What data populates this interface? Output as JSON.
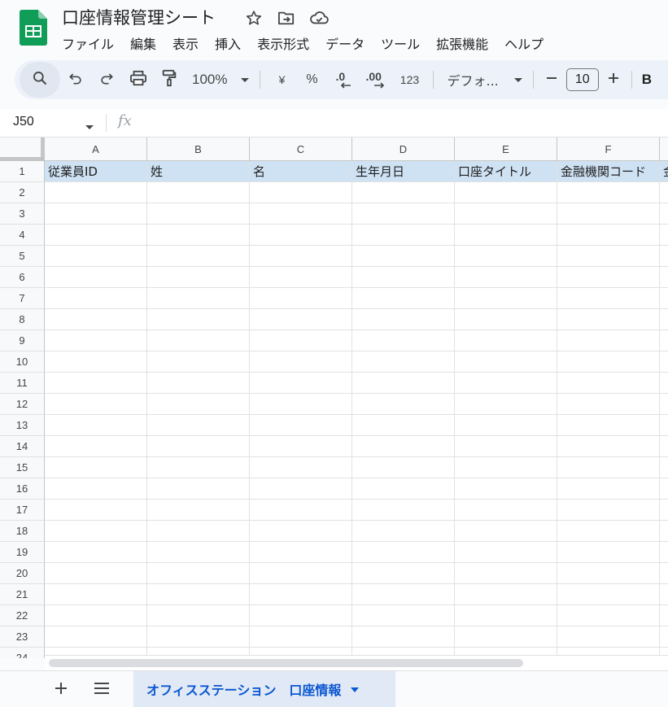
{
  "document": {
    "title": "口座情報管理シート"
  },
  "menu": [
    "ファイル",
    "編集",
    "表示",
    "挿入",
    "表示形式",
    "データ",
    "ツール",
    "拡張機能",
    "ヘルプ"
  ],
  "toolbar": {
    "zoom": "100%",
    "currency": "¥",
    "percent": "%",
    "decrease_decimal": ".0",
    "increase_decimal": ".00",
    "number_format": "123",
    "font_name": "デフォ...",
    "font_size": "10",
    "bold": "B"
  },
  "formula_bar": {
    "name_box": "J50",
    "fx": "fx"
  },
  "grid": {
    "columns": [
      "A",
      "B",
      "C",
      "D",
      "E",
      "F"
    ],
    "header_values": [
      "従業員ID",
      "姓",
      "名",
      "生年月日",
      "口座タイトル",
      "金融機関コード",
      "金"
    ],
    "row_numbers": [
      "1",
      "2",
      "3",
      "4",
      "5",
      "6",
      "7",
      "8",
      "9",
      "10",
      "11",
      "12",
      "13",
      "14",
      "15",
      "16",
      "17",
      "18",
      "19",
      "20",
      "21",
      "22",
      "23",
      "24"
    ],
    "header_fill_color": "#cfe2f3"
  },
  "sheet_tabs": [
    {
      "label": "オフィスステーション　口座情報",
      "active": true
    }
  ],
  "colors": {
    "brand_green": "#0f9d58",
    "accent_blue": "#0b57d0"
  }
}
